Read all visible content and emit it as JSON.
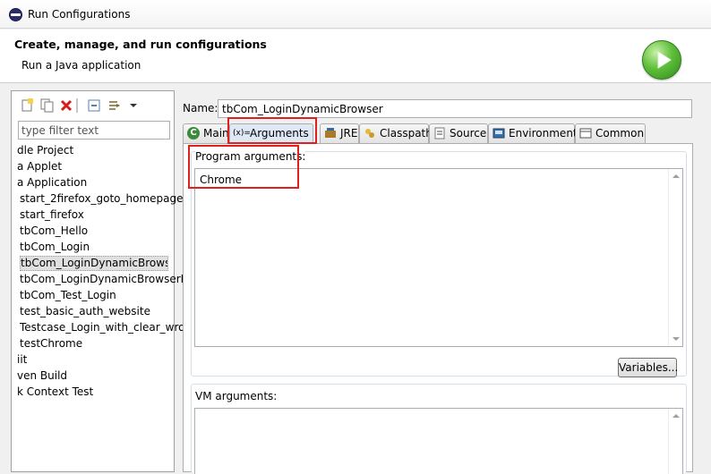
{
  "window": {
    "title": "Run Configurations"
  },
  "header": {
    "heading": "Create, manage, and run configurations",
    "subheading": "Run a Java application"
  },
  "left": {
    "filter_placeholder": "type filter text",
    "items": [
      {
        "label": "dle Project",
        "indent": 0
      },
      {
        "label": "a Applet",
        "indent": 0
      },
      {
        "label": "a Application",
        "indent": 0
      },
      {
        "label": "start_2firefox_goto_homepage",
        "indent": 1
      },
      {
        "label": "start_firefox",
        "indent": 1
      },
      {
        "label": "tbCom_Hello",
        "indent": 1
      },
      {
        "label": "tbCom_Login",
        "indent": 1
      },
      {
        "label": "tbCom_LoginDynamicBrowser",
        "indent": 1,
        "selected": true
      },
      {
        "label": "tbCom_LoginDynamicBrowserD",
        "indent": 1
      },
      {
        "label": "tbCom_Test_Login",
        "indent": 1
      },
      {
        "label": "test_basic_auth_website",
        "indent": 1
      },
      {
        "label": "Testcase_Login_with_clear_wror",
        "indent": 1
      },
      {
        "label": "testChrome",
        "indent": 1
      },
      {
        "label": "iit",
        "indent": 0
      },
      {
        "label": "ven Build",
        "indent": 0
      },
      {
        "label": "k Context Test",
        "indent": 0
      }
    ]
  },
  "right": {
    "name_label": "Name:",
    "name_value": "tbCom_LoginDynamicBrowser",
    "tabs": [
      {
        "label": "Main",
        "icon": "main-tab-icon"
      },
      {
        "label": "Arguments",
        "icon": "arguments-tab-icon",
        "active": true
      },
      {
        "label": "JRE",
        "icon": "jre-tab-icon"
      },
      {
        "label": "Classpath",
        "icon": "classpath-tab-icon"
      },
      {
        "label": "Source",
        "icon": "source-tab-icon"
      },
      {
        "label": "Environment",
        "icon": "environment-tab-icon"
      },
      {
        "label": "Common",
        "icon": "common-tab-icon"
      }
    ],
    "program_args_label": "Program arguments:",
    "program_args_value": "Chrome",
    "variables_label": "Variables...",
    "vm_args_label": "VM arguments:",
    "arguments_icon_text": "(x)="
  },
  "colors": {
    "highlight": "#e0201e",
    "run_green": "#3aa12a"
  }
}
